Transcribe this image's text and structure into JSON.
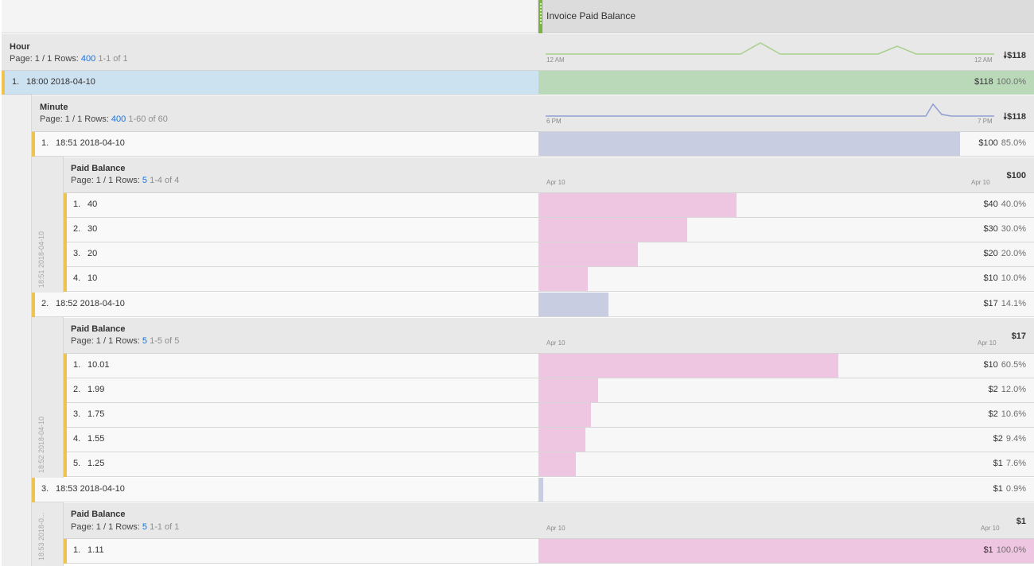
{
  "header": {
    "metric_title": "Invoice Paid Balance"
  },
  "hour": {
    "title": "Hour",
    "page_text": "Page: 1 / 1",
    "rows_label": "Rows:",
    "rows_value": "400",
    "range_text": "1-1 of 1",
    "axis_start": "12 AM",
    "axis_end": "12 AM",
    "total": "$118",
    "row": {
      "num": "1.",
      "label": "18:00 2018-04-10",
      "value": "$118",
      "pct": "100.0%",
      "share": 1.0
    }
  },
  "minute": {
    "title": "Minute",
    "page_text": "Page: 1 / 1",
    "rows_label": "Rows:",
    "rows_value": "400",
    "range_text": "1-60 of 60",
    "axis_start": "6 PM",
    "axis_end": "7 PM",
    "total": "$118",
    "rows": [
      {
        "num": "1.",
        "label": "18:51 2018-04-10",
        "value": "$100",
        "pct": "85.0%",
        "share": 0.85,
        "vlabel": "18:51 2018-04-10"
      },
      {
        "num": "2.",
        "label": "18:52 2018-04-10",
        "value": "$17",
        "pct": "14.1%",
        "share": 0.141,
        "vlabel": "18:52 2018-04-10"
      },
      {
        "num": "3.",
        "label": "18:53 2018-04-10",
        "value": "$1",
        "pct": "0.9%",
        "share": 0.009,
        "vlabel": "18:53 2018-0..."
      }
    ]
  },
  "paid_balance_1": {
    "title": "Paid Balance",
    "page_text": "Page: 1 / 1",
    "rows_label": "Rows:",
    "rows_value": "5",
    "range_text": "1-4 of 4",
    "axis_start": "Apr 10",
    "axis_end": "Apr 10",
    "total": "$100",
    "rows": [
      {
        "num": "1.",
        "label": "40",
        "value": "$40",
        "pct": "40.0%",
        "share": 0.4
      },
      {
        "num": "2.",
        "label": "30",
        "value": "$30",
        "pct": "30.0%",
        "share": 0.3
      },
      {
        "num": "3.",
        "label": "20",
        "value": "$20",
        "pct": "20.0%",
        "share": 0.2
      },
      {
        "num": "4.",
        "label": "10",
        "value": "$10",
        "pct": "10.0%",
        "share": 0.1
      }
    ]
  },
  "paid_balance_2": {
    "title": "Paid Balance",
    "page_text": "Page: 1 / 1",
    "rows_label": "Rows:",
    "rows_value": "5",
    "range_text": "1-5 of 5",
    "axis_start": "Apr 10",
    "axis_end": "Apr 10",
    "total": "$17",
    "rows": [
      {
        "num": "1.",
        "label": "10.01",
        "value": "$10",
        "pct": "60.5%",
        "share": 0.605
      },
      {
        "num": "2.",
        "label": "1.99",
        "value": "$2",
        "pct": "12.0%",
        "share": 0.12
      },
      {
        "num": "3.",
        "label": "1.75",
        "value": "$2",
        "pct": "10.6%",
        "share": 0.106
      },
      {
        "num": "4.",
        "label": "1.55",
        "value": "$2",
        "pct": "9.4%",
        "share": 0.094
      },
      {
        "num": "5.",
        "label": "1.25",
        "value": "$1",
        "pct": "7.6%",
        "share": 0.076
      }
    ]
  },
  "paid_balance_3": {
    "title": "Paid Balance",
    "page_text": "Page: 1 / 1",
    "rows_label": "Rows:",
    "rows_value": "5",
    "range_text": "1-1 of 1",
    "axis_start": "Apr 10",
    "axis_end": "Apr 10",
    "total": "$1",
    "rows": [
      {
        "num": "1.",
        "label": "1.11",
        "value": "$1",
        "pct": "100.0%",
        "share": 1.0
      }
    ]
  },
  "colors": {
    "hour_bar": "#b9d9b9",
    "hour_row_bg": "#cde2f0",
    "minute_bar": "#c8cde2",
    "balance_bar": "#efc6e1",
    "accent_bar": "#f0c350",
    "sparkline_hour": "#a6d08a",
    "sparkline_minute": "#8f9fd0",
    "link_blue": "#1473e6"
  }
}
